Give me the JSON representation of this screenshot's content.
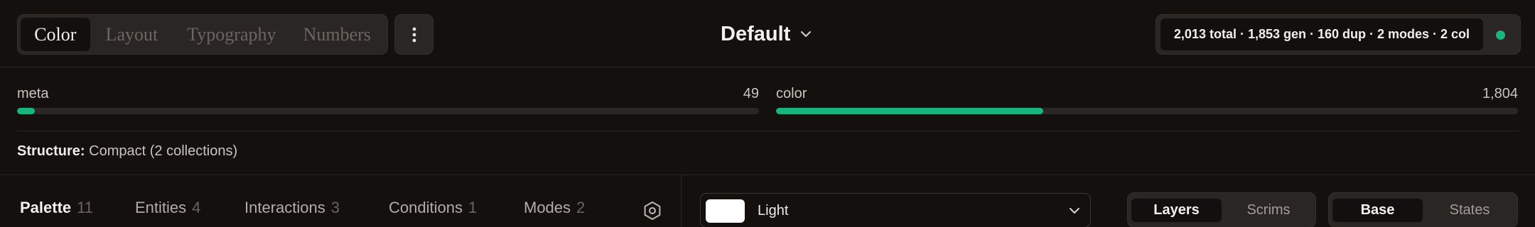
{
  "category_tabs": [
    {
      "label": "Color",
      "active": true
    },
    {
      "label": "Layout",
      "active": false
    },
    {
      "label": "Typography",
      "active": false
    },
    {
      "label": "Numbers",
      "active": false
    }
  ],
  "menu_icon": "⋮",
  "theme": {
    "name": "Default",
    "icon": "chevron-down-icon"
  },
  "stats": {
    "summary": "2,013 total · 1,853 gen · 160 dup · 2 modes · 2 col",
    "status_color": "#19b57e"
  },
  "collections": [
    {
      "label": "meta",
      "count": "49",
      "fraction": 0.0243
    },
    {
      "label": "color",
      "count": "1,804",
      "fraction": 0.3605
    }
  ],
  "structure": {
    "label": "Structure:",
    "value": "Compact (2 collections)"
  },
  "section_tabs": [
    {
      "label": "Palette",
      "count": "11",
      "active": true
    },
    {
      "label": "Entities",
      "count": "4",
      "active": false
    },
    {
      "label": "Interactions",
      "count": "3",
      "active": false
    },
    {
      "label": "Conditions",
      "count": "1",
      "active": false
    },
    {
      "label": "Modes",
      "count": "2",
      "active": false
    }
  ],
  "settings_icon": "hexagon-settings-icon",
  "mode_select": {
    "value": "Light",
    "swatch_color": "#ffffff"
  },
  "view_toggle": {
    "options": [
      "Layers",
      "Scrims"
    ],
    "selected": "Layers"
  },
  "state_toggle": {
    "options": [
      "Base",
      "States"
    ],
    "selected": "Base"
  },
  "colors": {
    "accent": "#19b57e",
    "background": "#13100e",
    "surface": "#2a2623"
  }
}
